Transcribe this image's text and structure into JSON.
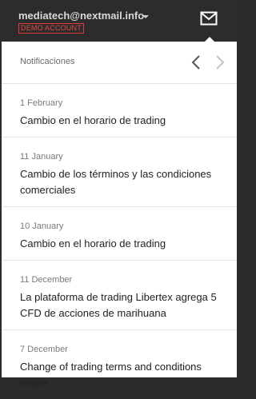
{
  "account": {
    "email": "mediatech@nextmail.info",
    "badge": "DEMO ACCOUNT"
  },
  "icons": {
    "mail": "envelope-icon",
    "caret": "caret-down-icon",
    "prev": "chevron-left-icon",
    "next": "chevron-right-icon"
  },
  "colors": {
    "topbar": "#2c2c2c",
    "badge": "#e03a3a"
  },
  "panel": {
    "title": "Notificaciones",
    "notifications": [
      {
        "date": "1 February",
        "title": "Cambio en el horario de trading"
      },
      {
        "date": "11 January",
        "title": "Cambio de los términos y las condiciones comerciales"
      },
      {
        "date": "10 January",
        "title": "Cambio en el horario de trading"
      },
      {
        "date": "11 December",
        "title": "La plataforma de trading Libertex agrega 5 CFD de acciones de marihuana"
      },
      {
        "date": "7 December",
        "title": "Change of trading terms and conditions notice"
      }
    ]
  }
}
